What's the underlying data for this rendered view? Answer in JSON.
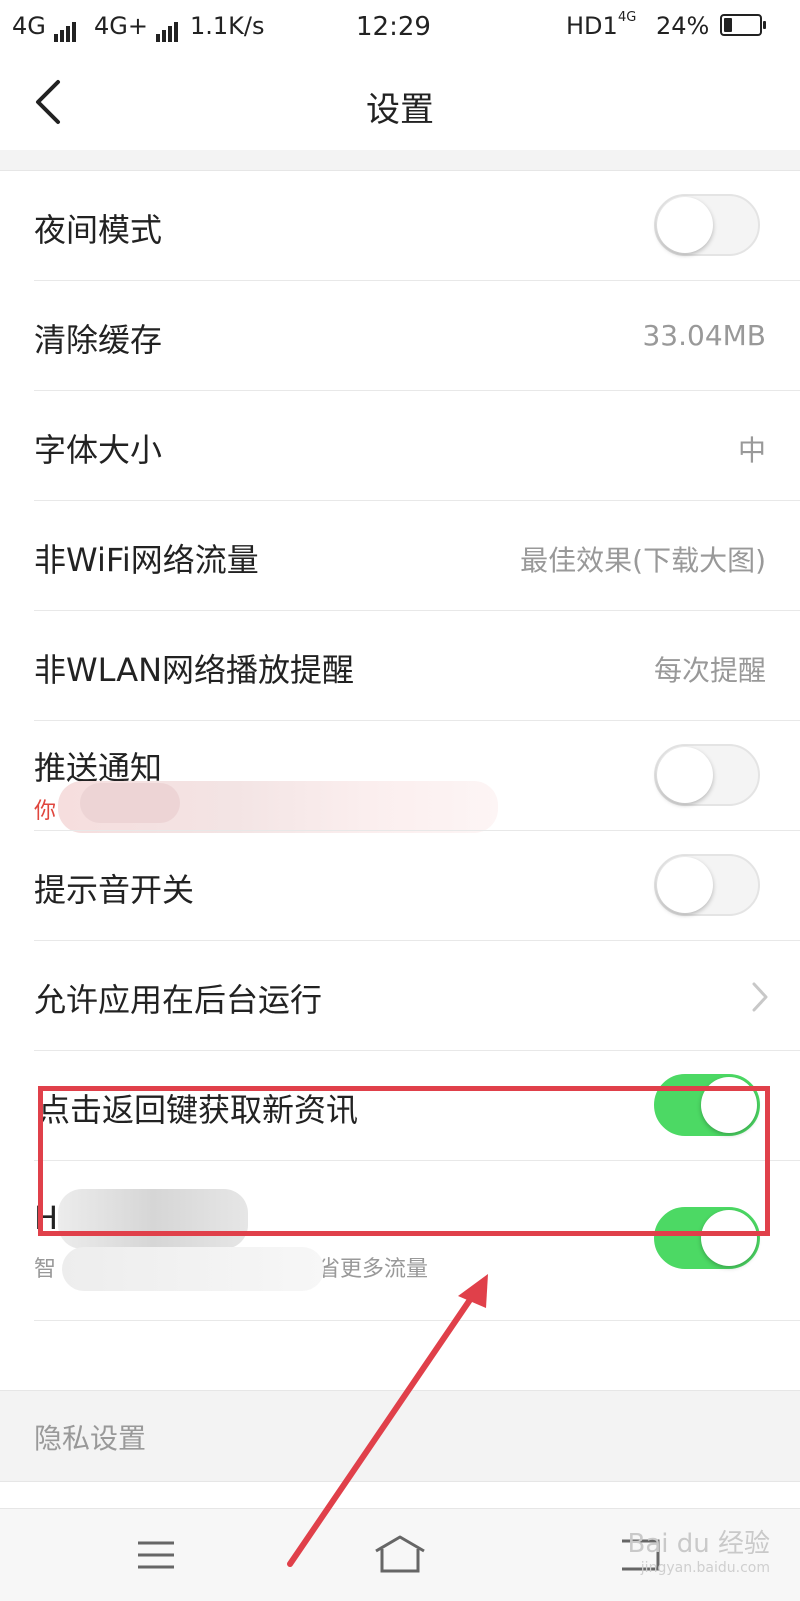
{
  "status_bar": {
    "net1": "4G",
    "net2": "4G+",
    "speed": "1.1K/s",
    "time": "12:29",
    "hd": "HD1",
    "net3": "4G",
    "battery_percent": "24%",
    "battery_level": 0.24
  },
  "header": {
    "title": "设置"
  },
  "settings": [
    {
      "label": "夜间模式",
      "toggle": false
    },
    {
      "label": "清除缓存",
      "value": "33.04MB"
    },
    {
      "label": "字体大小",
      "value": "中"
    },
    {
      "label": "非WiFi网络流量",
      "value": "最佳效果(下载大图)"
    },
    {
      "label": "非WLAN网络播放提醒",
      "value": "每次提醒"
    },
    {
      "label": "推送通知",
      "sublabel": "你",
      "toggle": false
    },
    {
      "label": "提示音开关",
      "toggle": false
    },
    {
      "label": "允许应用在后台运行"
    },
    {
      "label": "点击返回键获取新资讯",
      "toggle": true
    },
    {
      "label": "H",
      "sublabel_prefix": "智",
      "sublabel_suffix": "节省更多流量",
      "toggle": true
    }
  ],
  "sections": {
    "privacy": "隐私设置"
  },
  "watermark": {
    "text": "Bai du 经验",
    "url": "jingyan.baidu.com"
  },
  "colors": {
    "toggle_on": "#4cd964",
    "annotation_red": "#e0404a",
    "sub_text_red": "#e0463e"
  }
}
